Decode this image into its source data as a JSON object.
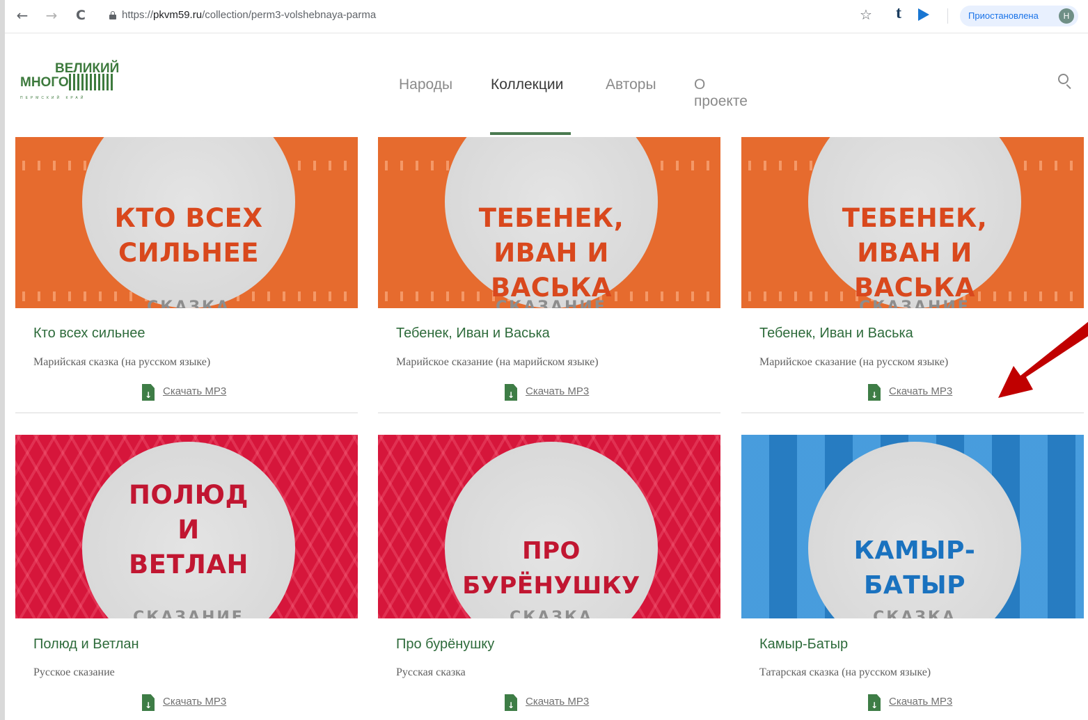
{
  "browser": {
    "url_scheme": "https://",
    "url_host": "pkvm59.ru",
    "url_path": "/collection/perm3-volshebnaya-parma",
    "back_icon": "←",
    "forward_icon": "→",
    "reload_icon": "C",
    "star_icon": "☆",
    "tumblr_icon": "t",
    "profile_status": "Приостановлена",
    "profile_initial": "Н"
  },
  "site": {
    "logo_line1": "ВЕЛИКИЙ",
    "logo_line2": "МНОГО",
    "logo_sub": "ПЕРМСКИЙ КРАЙ",
    "nav": [
      {
        "label": "Народы",
        "active": false
      },
      {
        "label": "Коллекции",
        "active": true
      },
      {
        "label": "Авторы",
        "active": false
      },
      {
        "label": "О проекте",
        "active": false
      }
    ]
  },
  "cards": [
    {
      "cover_lines": [
        "КТО ВСЕХ",
        "СИЛЬНЕЕ"
      ],
      "cover_under": "СКАЗКА",
      "title": "Кто всех сильнее",
      "subtitle": "Марийская сказка (на русском языке)",
      "download": "Скачать MP3",
      "theme": "orange"
    },
    {
      "cover_lines": [
        "ТЕБЕНЕК,",
        "ИВАН И ВАСЬКА"
      ],
      "cover_under": "СКАЗАНИЕ",
      "title": "Тебенек, Иван и Васька",
      "subtitle": "Марийское сказание (на марийском языке)",
      "download": "Скачать MP3",
      "theme": "orange"
    },
    {
      "cover_lines": [
        "ТЕБЕНЕК,",
        "ИВАН И ВАСЬКА"
      ],
      "cover_under": "СКАЗАНИЕ",
      "title": "Тебенек, Иван и Васька",
      "subtitle": "Марийское сказание (на русском языке)",
      "download": "Скачать MP3",
      "theme": "orange"
    },
    {
      "cover_lines": [
        "ПОЛЮД",
        "И",
        "ВЕТЛАН"
      ],
      "cover_under": "СКАЗАНИЕ",
      "title": "Полюд и Ветлан",
      "subtitle": "Русское сказание",
      "download": "Скачать MP3",
      "theme": "red"
    },
    {
      "cover_lines": [
        "ПРО БУРЁНУШКУ"
      ],
      "cover_under": "СКАЗКА",
      "title": "Про бурёнушку",
      "subtitle": "Русская сказка",
      "download": "Скачать MP3",
      "theme": "red"
    },
    {
      "cover_lines": [
        "КАМЫР-БАТЫР"
      ],
      "cover_under": "СКАЗКА",
      "title": "Камыр-Батыр",
      "subtitle": "Татарская сказка (на русском языке)",
      "download": "Скачать MP3",
      "theme": "blue"
    }
  ],
  "colors": {
    "accent_green": "#3e7d46",
    "orange_cover": "#e66b2e",
    "red_cover": "#d6163b",
    "blue_cover": "#2f8fd8",
    "annotation_arrow": "#c00000"
  }
}
